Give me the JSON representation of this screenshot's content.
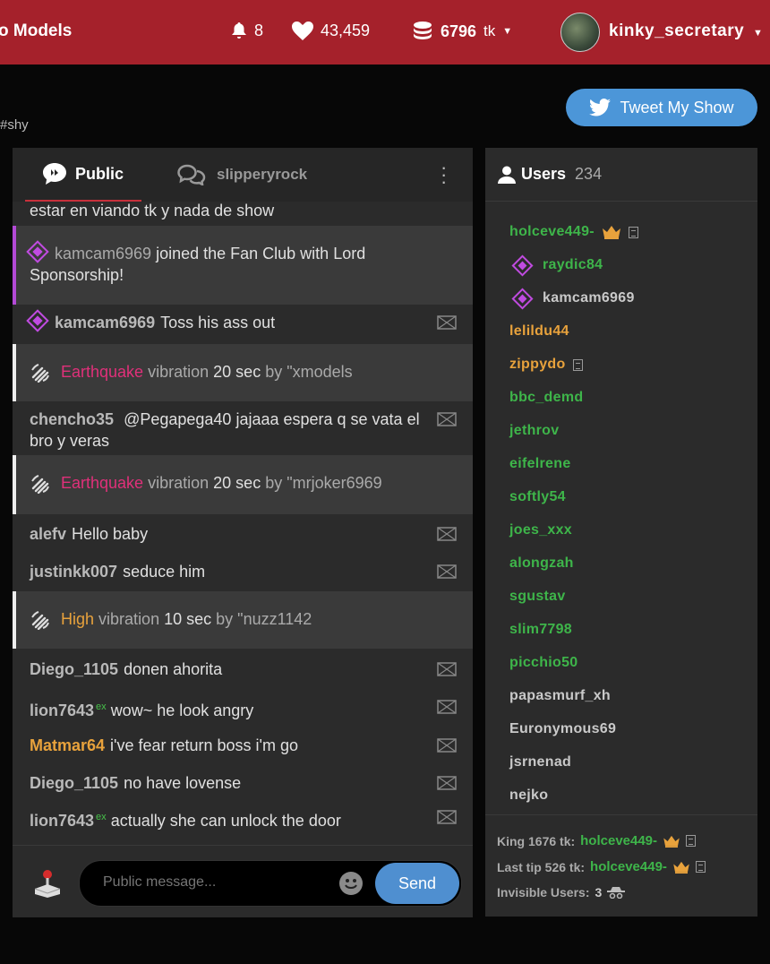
{
  "topbar": {
    "models_label": "o Models",
    "notifications": "8",
    "likes": "43,459",
    "tokens": "6796",
    "tokens_unit": "tk",
    "username": "kinky_secretary"
  },
  "tweet_button": "Tweet My Show",
  "hashtag": "#shy",
  "chat": {
    "tab_public": "Public",
    "tab_model": "slipperyrock",
    "messages": [
      {
        "text": "estar en viando tk y nada de show"
      },
      {
        "user": "kamcam6969",
        "text": "joined the Fan Club with Lord Sponsorship!"
      },
      {
        "user": "kamcam6969",
        "text": "Toss his ass out"
      },
      {
        "level": "Earthquake",
        "vib": "vibration",
        "dur": "20 sec",
        "by": "by \"xmodels"
      },
      {
        "user": "chencho35",
        "text": "@Pegapega40  jajaaa espera q se vata el bro y veras"
      },
      {
        "level": "Earthquake",
        "vib": "vibration",
        "dur": "20 sec",
        "by": "by \"mrjoker6969"
      },
      {
        "user": "alefv",
        "text": "Hello baby"
      },
      {
        "user": "justinkk007",
        "text": "seduce him"
      },
      {
        "level": "High",
        "vib": "vibration",
        "dur": "10 sec",
        "by": "by \"nuzz1142"
      },
      {
        "user": "Diego_1105",
        "text": "donen ahorita"
      },
      {
        "user": "lion7643",
        "sup": "ex",
        "text": "wow~ he look angry"
      },
      {
        "user": "Matmar64",
        "text": "i've fear return boss i'm go"
      },
      {
        "user": "Diego_1105",
        "text": "no have lovense"
      },
      {
        "user": "lion7643",
        "sup": "ex",
        "text": "actually she can unlock the door"
      }
    ],
    "input_placeholder": "Public message...",
    "send_label": "Send"
  },
  "users": {
    "title": "Users",
    "count": "234",
    "list": [
      "holceve449-",
      "raydic84",
      "kamcam6969",
      "lelildu44",
      "zippydo",
      "bbc_demd",
      "jethrov",
      "eifelrene",
      "softly54",
      "joes_xxx",
      "alongzah",
      "sgustav",
      "slim7798",
      "picchio50",
      "papasmurf_xh",
      "Euronymous69",
      "jsrnenad",
      "nejko"
    ],
    "king_label": "King 1676 tk:",
    "king_user": "holceve449-",
    "last_tip_label": "Last tip 526 tk:",
    "last_tip_user": "holceve449-",
    "invisible_label": "Invisible Users:",
    "invisible_count": "3"
  },
  "colors": {
    "topbar": "#a5212b",
    "accent_blue": "#4c96d8",
    "green_user": "#3eb54a",
    "gold_user": "#e8a23c",
    "purple_fan": "#c04be0",
    "pink_vibe": "#e0307a"
  }
}
